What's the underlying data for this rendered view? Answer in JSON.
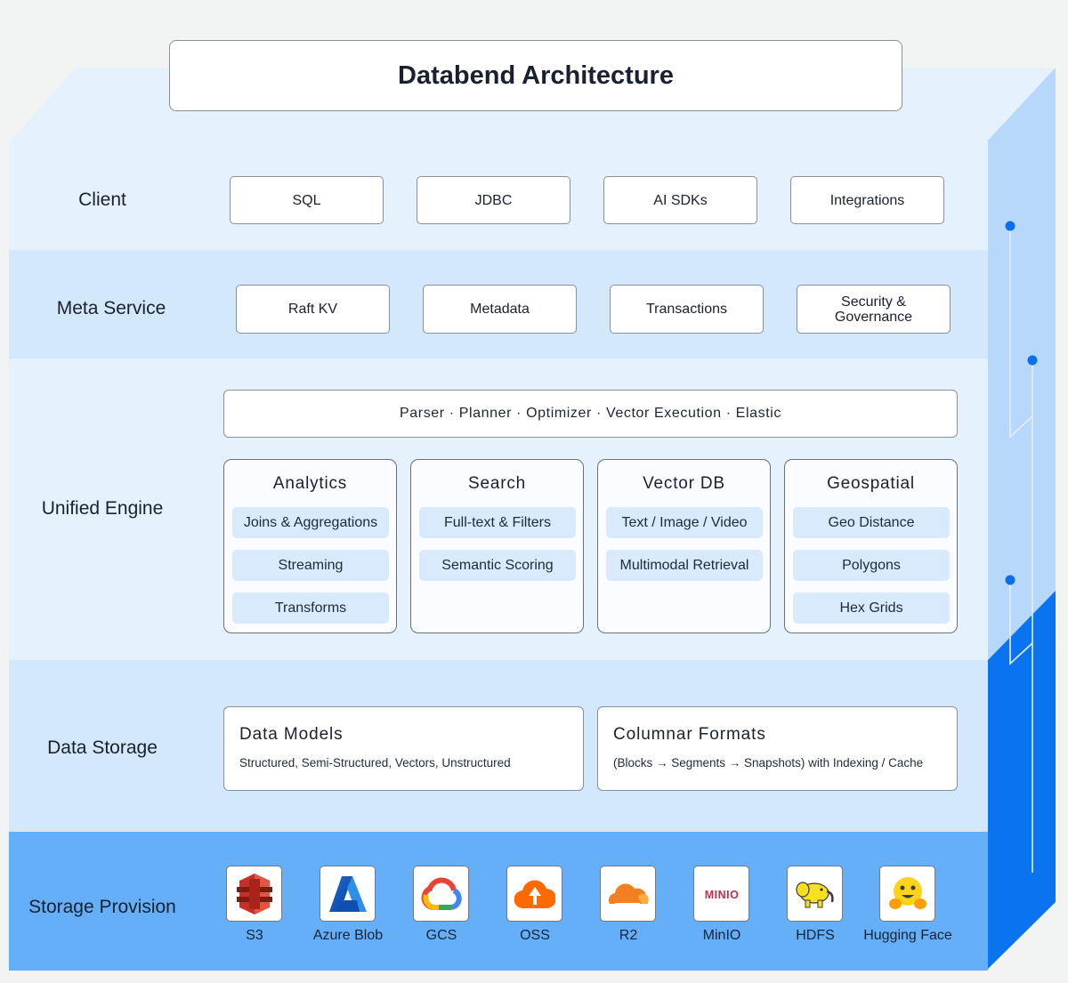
{
  "title": "Databend Architecture",
  "layers": {
    "client": {
      "label": "Client",
      "items": [
        "SQL",
        "JDBC",
        "AI SDKs",
        "Integrations"
      ]
    },
    "meta": {
      "label": "Meta Service",
      "items": [
        "Raft KV",
        "Metadata",
        "Transactions",
        "Security & Governance"
      ]
    },
    "engine": {
      "label": "Unified Engine",
      "pipeline": "Parser · Planner · Optimizer · Vector Execution · Elastic",
      "modules": [
        {
          "title": "Analytics",
          "items": [
            "Joins & Aggregations",
            "Streaming",
            "Transforms"
          ]
        },
        {
          "title": "Search",
          "items": [
            "Full-text & Filters",
            "Semantic Scoring"
          ]
        },
        {
          "title": "Vector DB",
          "items": [
            "Text / Image / Video",
            "Multimodal Retrieval"
          ]
        },
        {
          "title": "Geospatial",
          "items": [
            "Geo Distance",
            "Polygons",
            "Hex Grids"
          ]
        }
      ]
    },
    "storage": {
      "label": "Data Storage",
      "boxes": [
        {
          "title": "Data Models",
          "desc": "Structured, Semi-Structured, Vectors, Unstructured"
        },
        {
          "title": "Columnar Formats",
          "desc": "(Blocks → Segments → Snapshots) with Indexing / Cache"
        }
      ]
    },
    "provision": {
      "label": "Storage Provision",
      "providers": [
        {
          "label": "S3",
          "icon": "aws-s3-icon"
        },
        {
          "label": "Azure Blob",
          "icon": "azure-icon"
        },
        {
          "label": "GCS",
          "icon": "google-cloud-icon"
        },
        {
          "label": "OSS",
          "icon": "alibaba-oss-icon"
        },
        {
          "label": "R2",
          "icon": "cloudflare-icon"
        },
        {
          "label": "MinIO",
          "icon": "minio-icon",
          "logo_text": "MINIO"
        },
        {
          "label": "HDFS",
          "icon": "hadoop-elephant-icon"
        },
        {
          "label": "Hugging Face",
          "icon": "hugging-face-icon"
        }
      ]
    }
  },
  "colors": {
    "band_light": "#e5f1fd",
    "band_mid": "#d4e8fb",
    "band_provision": "#64aff7",
    "side_light": "#b7d8fb",
    "side_dark": "#0a74f0",
    "accent_dot": "#0d6fe8"
  }
}
